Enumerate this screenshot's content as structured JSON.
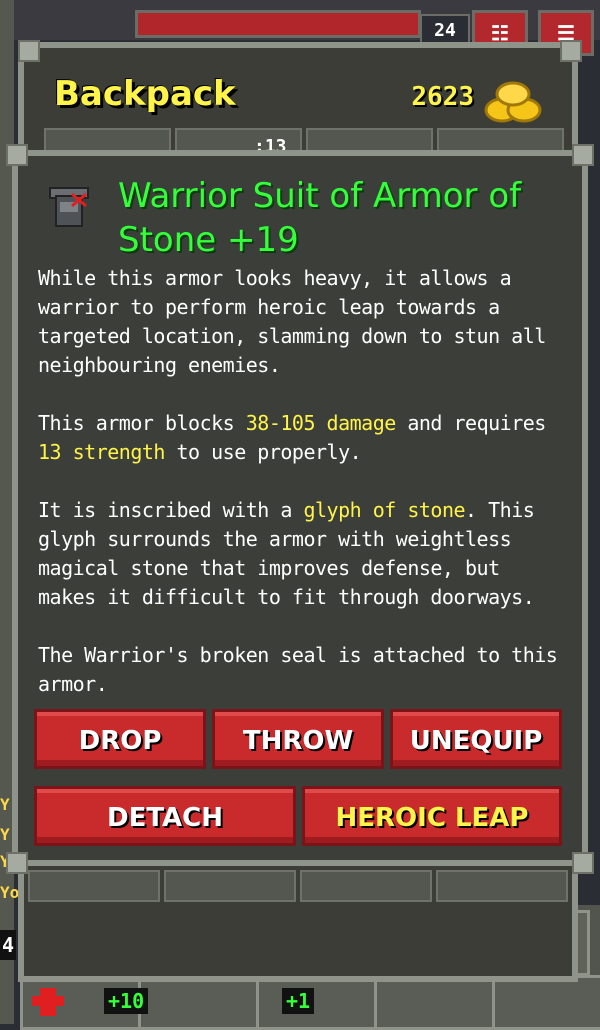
{
  "hud": {
    "depth": "24",
    "journal_icon": "journal-icon",
    "menu_icon": "menu-icon",
    "side_tags": [
      "Y",
      "Y",
      "Y",
      "Yo"
    ],
    "side_number": "4"
  },
  "backpack": {
    "title": "Backpack",
    "gold": "2623",
    "gold_icon": "gold-pile-icon",
    "slot_label": ":13"
  },
  "item": {
    "icon": "armor-icon",
    "title": "Warrior Suit of Armor of Stone +19",
    "p1": "While this armor looks heavy, it allows a warrior to perform heroic leap towards a targeted location, slamming down to stun all neighbouring enemies.",
    "p2_a": "This armor blocks ",
    "p2_dmg": "38-105 damage",
    "p2_b": " and requires ",
    "p2_str": "13 strength",
    "p2_c": " to use properly.",
    "p3_a": "It is inscribed with a ",
    "p3_glyph": "glyph of stone",
    "p3_b": ". This glyph surrounds the armor with weightless magical stone that improves defense, but makes it difficult to fit through doorways.",
    "p4": "The Warrior's broken seal is attached to this armor.",
    "highlight_color": "#fff44a",
    "title_color": "#33ff3a"
  },
  "actions": {
    "drop": "DROP",
    "throw": "THROW",
    "unequip": "UNEQUIP",
    "detach": "DETACH",
    "heroic_leap": "HEROIC LEAP"
  },
  "quickbar": {
    "badge_1": "+10",
    "badge_2": "+1"
  },
  "colors": {
    "button_red": "#c92b2d",
    "gold_text": "#fff44a"
  }
}
